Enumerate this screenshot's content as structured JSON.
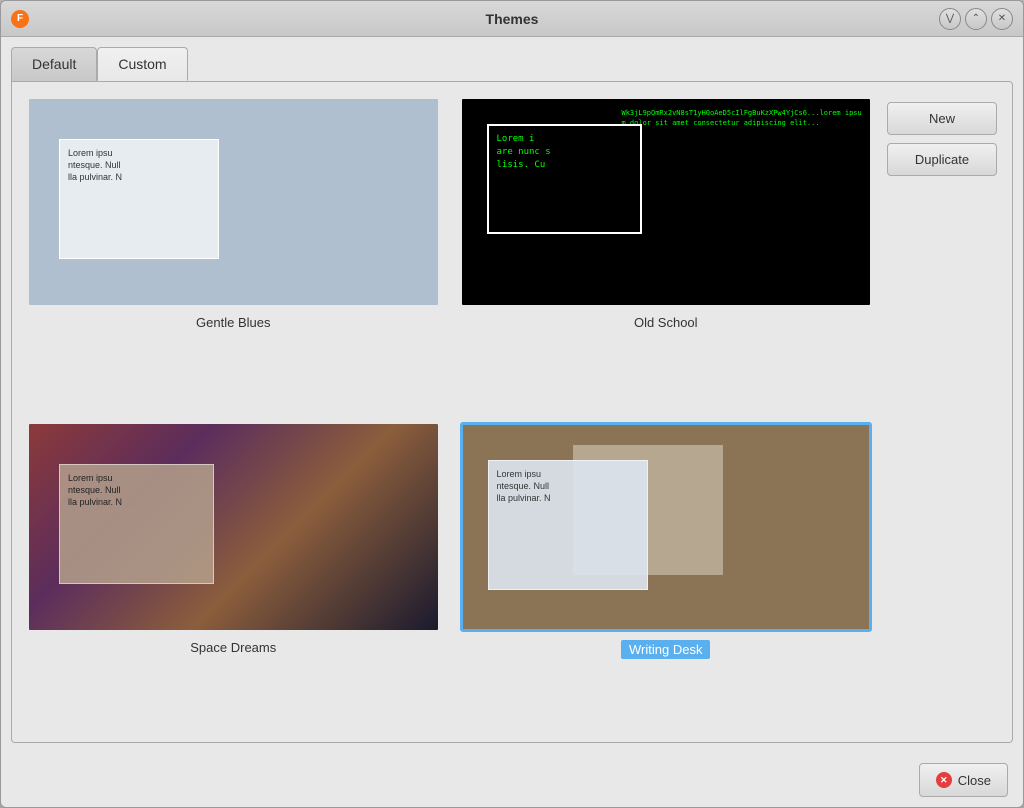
{
  "window": {
    "title": "Themes",
    "icon": "F"
  },
  "tabs": [
    {
      "id": "default",
      "label": "Default",
      "active": false
    },
    {
      "id": "custom",
      "label": "Custom",
      "active": true
    }
  ],
  "themes": [
    {
      "id": "gentle-blues",
      "label": "Gentle Blues",
      "selected": false,
      "text_preview": [
        "Lorem ipsu",
        "ntesque. Null",
        "lla pulvinar. N"
      ]
    },
    {
      "id": "old-school",
      "label": "Old School",
      "selected": false,
      "text_preview": [
        "Lorem i",
        "are nunc s",
        "lisis. Cu"
      ]
    },
    {
      "id": "space-dreams",
      "label": "Space Dreams",
      "selected": false,
      "text_preview": [
        "Lorem ipsu",
        "ntesque. Null",
        "lla pulvinar. N"
      ]
    },
    {
      "id": "writing-desk",
      "label": "Writing Desk",
      "selected": true,
      "text_preview": [
        "Lorem ipsu",
        "ntesque. Null",
        "lla pulvinar. N"
      ]
    }
  ],
  "buttons": {
    "new_label": "New",
    "duplicate_label": "Duplicate",
    "close_label": "Close"
  }
}
